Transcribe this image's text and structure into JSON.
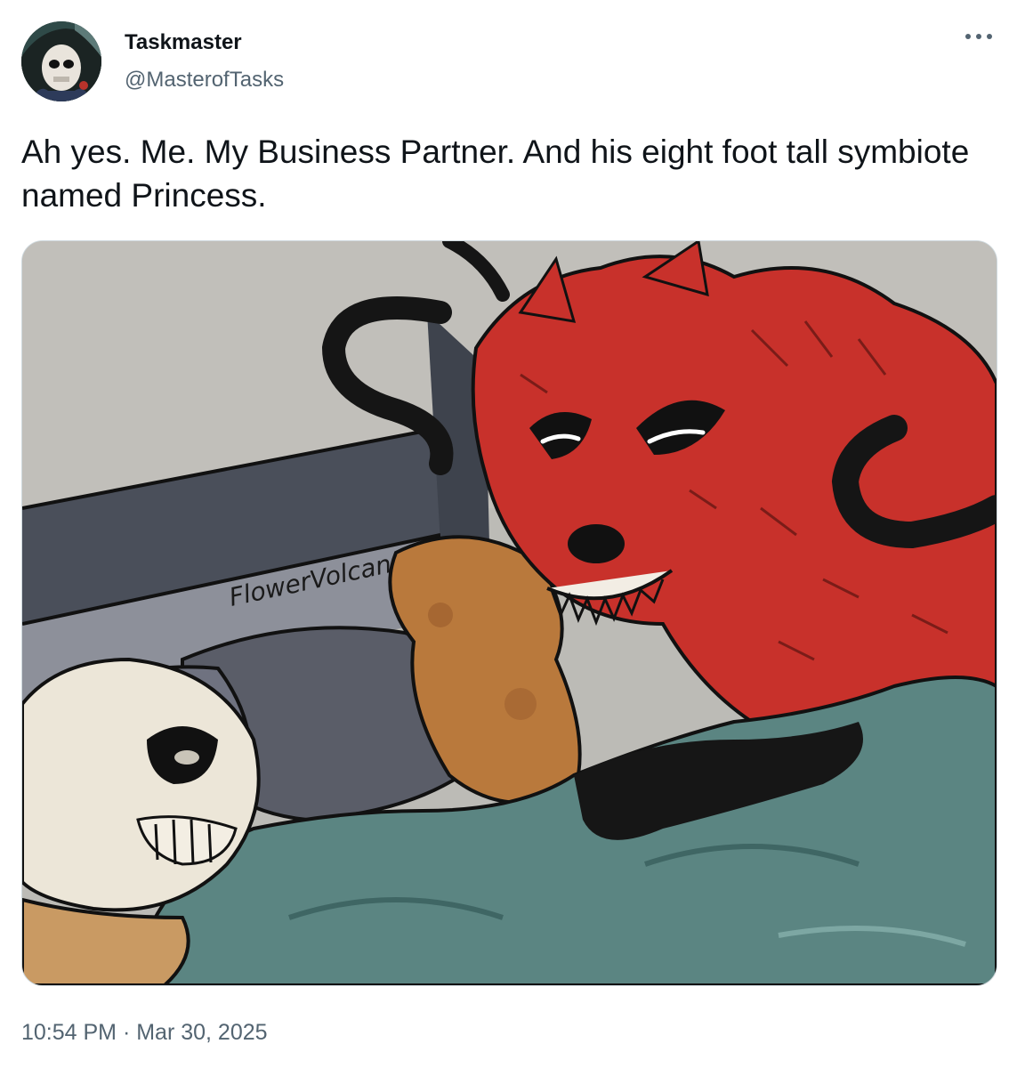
{
  "author": {
    "name": "Taskmaster",
    "handle": "@MasterofTasks",
    "avatar_icon": "skull-mask-avatar"
  },
  "more_icon": "more-horizontal-icon",
  "tweet": {
    "text": "Ah yes. Me. My Business Partner. And his eight foot tall symbiote named Princess."
  },
  "media": {
    "signature": "FlowerVolcano"
  },
  "meta": {
    "time": "10:54 PM",
    "separator": " · ",
    "date": "Mar 30, 2025"
  },
  "colors": {
    "handle": "#536471",
    "symbiote_red": "#c8312b",
    "blanket_teal": "#5b8582"
  }
}
